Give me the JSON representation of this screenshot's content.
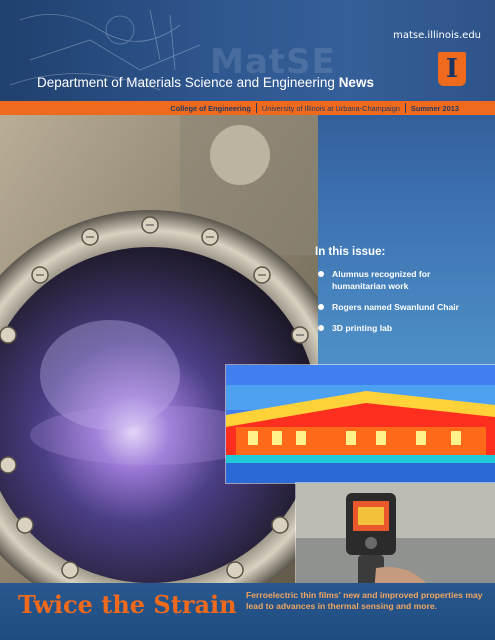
{
  "header": {
    "site_url": "matse.illinois.edu",
    "watermark": "MatSE",
    "title_prefix": "Department of Materials Science and Engineering",
    "title_suffix": "News",
    "logo_letter": "I",
    "ribbon": {
      "college": "College of Engineering",
      "university": "University of Illinois at Urbana-Champaign",
      "issue_date": "Summer 2013"
    }
  },
  "in_this_issue": {
    "heading": "In this issue:",
    "items": [
      "Alumnus recognized for humanitarian work",
      "Rogers named Swanlund Chair",
      "3D printing lab"
    ]
  },
  "feature": {
    "headline": "Twice the Strain",
    "dek": "Ferroelectric thin films' new and improved properties may lead to advances in thermal sensing and more."
  },
  "colors": {
    "accent": "#f06a1d",
    "navy": "#1f3a66",
    "background": "#3b6aa8"
  }
}
